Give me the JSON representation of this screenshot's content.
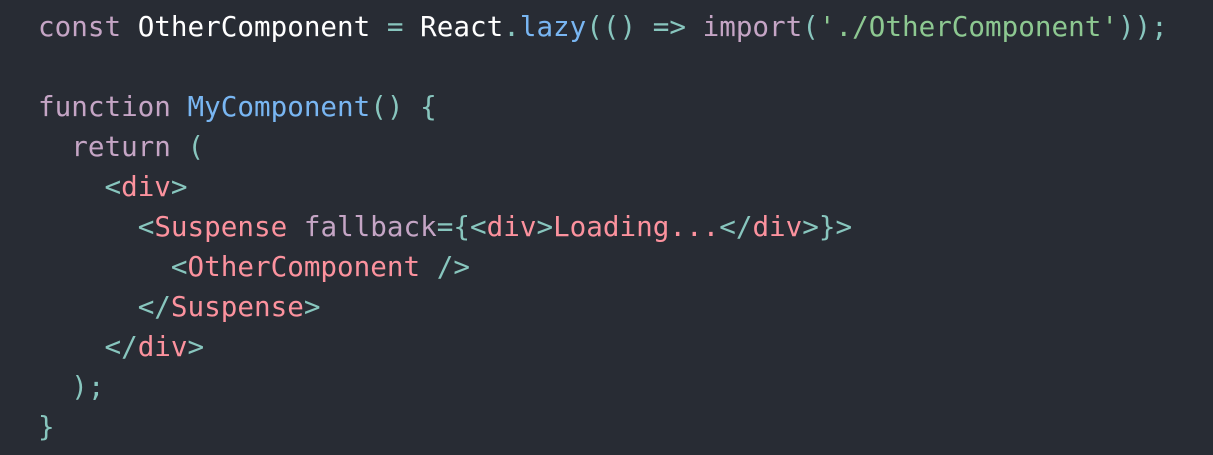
{
  "editor": {
    "background": "#282c34",
    "colors": {
      "keyword": "#c5a5c5",
      "function": "#79b6f2",
      "punctuation": "#88c6be",
      "tag": "#fc929e",
      "attribute": "#c5a5c5",
      "string": "#8dc891",
      "plain": "#ffffff"
    },
    "lines": [
      [
        {
          "t": "keyword",
          "v": "const"
        },
        {
          "t": "plain",
          "v": " OtherComponent "
        },
        {
          "t": "punct",
          "v": "="
        },
        {
          "t": "plain",
          "v": " React"
        },
        {
          "t": "punct",
          "v": "."
        },
        {
          "t": "func",
          "v": "lazy"
        },
        {
          "t": "punct",
          "v": "(() =>"
        },
        {
          "t": "plain",
          "v": " "
        },
        {
          "t": "keyword",
          "v": "import"
        },
        {
          "t": "punct",
          "v": "("
        },
        {
          "t": "string",
          "v": "'./OtherComponent'"
        },
        {
          "t": "punct",
          "v": "));"
        }
      ],
      [],
      [
        {
          "t": "keyword",
          "v": "function"
        },
        {
          "t": "plain",
          "v": " "
        },
        {
          "t": "func",
          "v": "MyComponent"
        },
        {
          "t": "punct",
          "v": "() {"
        }
      ],
      [
        {
          "t": "plain",
          "v": "  "
        },
        {
          "t": "keyword",
          "v": "return"
        },
        {
          "t": "plain",
          "v": " "
        },
        {
          "t": "punct",
          "v": "("
        }
      ],
      [
        {
          "t": "plain",
          "v": "    "
        },
        {
          "t": "punct",
          "v": "<"
        },
        {
          "t": "tag",
          "v": "div"
        },
        {
          "t": "punct",
          "v": ">"
        }
      ],
      [
        {
          "t": "plain",
          "v": "      "
        },
        {
          "t": "punct",
          "v": "<"
        },
        {
          "t": "tag",
          "v": "Suspense"
        },
        {
          "t": "plain",
          "v": " "
        },
        {
          "t": "attr",
          "v": "fallback"
        },
        {
          "t": "punct",
          "v": "={<"
        },
        {
          "t": "tag",
          "v": "div"
        },
        {
          "t": "punct",
          "v": ">"
        },
        {
          "t": "text",
          "v": "Loading..."
        },
        {
          "t": "punct",
          "v": "</"
        },
        {
          "t": "tag",
          "v": "div"
        },
        {
          "t": "punct",
          "v": ">}>"
        }
      ],
      [
        {
          "t": "plain",
          "v": "        "
        },
        {
          "t": "punct",
          "v": "<"
        },
        {
          "t": "tag",
          "v": "OtherComponent"
        },
        {
          "t": "plain",
          "v": " "
        },
        {
          "t": "punct",
          "v": "/>"
        }
      ],
      [
        {
          "t": "plain",
          "v": "      "
        },
        {
          "t": "punct",
          "v": "</"
        },
        {
          "t": "tag",
          "v": "Suspense"
        },
        {
          "t": "punct",
          "v": ">"
        }
      ],
      [
        {
          "t": "plain",
          "v": "    "
        },
        {
          "t": "punct",
          "v": "</"
        },
        {
          "t": "tag",
          "v": "div"
        },
        {
          "t": "punct",
          "v": ">"
        }
      ],
      [
        {
          "t": "plain",
          "v": "  "
        },
        {
          "t": "punct",
          "v": ");"
        }
      ],
      [
        {
          "t": "punct",
          "v": "}"
        }
      ]
    ]
  }
}
